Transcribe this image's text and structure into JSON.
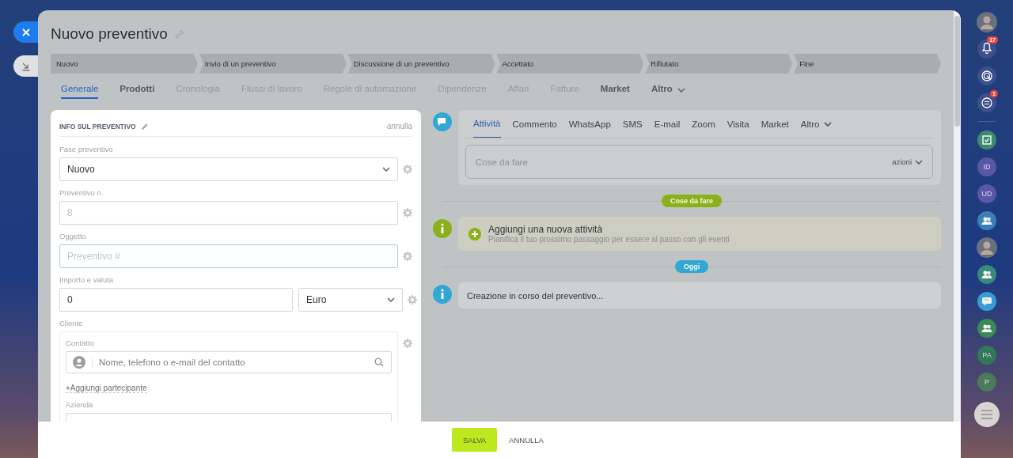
{
  "header": {
    "title": "Nuovo preventivo"
  },
  "stages": [
    {
      "label": "Nuovo"
    },
    {
      "label": "Invio di un preventivo"
    },
    {
      "label": "Discussione di un preventivo"
    },
    {
      "label": "Accettato"
    },
    {
      "label": "Rifiutato"
    },
    {
      "label": "Fine"
    }
  ],
  "tabs": [
    {
      "label": "Generale",
      "selected": true,
      "disabled": false,
      "dropdown": false
    },
    {
      "label": "Prodotti",
      "selected": false,
      "disabled": false,
      "dropdown": false
    },
    {
      "label": "Cronologia",
      "selected": false,
      "disabled": true,
      "dropdown": false
    },
    {
      "label": "Flussi di lavoro",
      "selected": false,
      "disabled": true,
      "dropdown": false
    },
    {
      "label": "Regole di automazione",
      "selected": false,
      "disabled": true,
      "dropdown": false
    },
    {
      "label": "Dipendenze",
      "selected": false,
      "disabled": true,
      "dropdown": false
    },
    {
      "label": "Affari",
      "selected": false,
      "disabled": true,
      "dropdown": false
    },
    {
      "label": "Fatture",
      "selected": false,
      "disabled": true,
      "dropdown": false
    },
    {
      "label": "Market",
      "selected": false,
      "disabled": false,
      "dropdown": false
    },
    {
      "label": "Altro",
      "selected": false,
      "disabled": false,
      "dropdown": true
    }
  ],
  "info_card": {
    "title": "INFO SUL PREVENTIVO",
    "cancel": "annulla",
    "fields": [
      {
        "kind": "select",
        "label": "Fase preventivo",
        "value": "Nuovo"
      },
      {
        "kind": "input",
        "label": "Preventivo n.",
        "placeholder": "8",
        "focused": false
      },
      {
        "kind": "input",
        "label": "Oggetto",
        "placeholder": "Preventivo #",
        "focused": true
      },
      {
        "kind": "money",
        "label": "Importo e valuta",
        "value": "0",
        "currency": "Euro"
      },
      {
        "kind": "client",
        "label": "Cliente",
        "contact_label": "Contatto",
        "contact_placeholder": "Nome, telefono o e-mail del contatto",
        "add_link": "+Aggiungi partecipante",
        "company_label": "Azienda"
      }
    ]
  },
  "timeline": {
    "tabs": [
      {
        "label": "Attività",
        "selected": true,
        "dropdown": false
      },
      {
        "label": "Commento",
        "selected": false,
        "dropdown": false
      },
      {
        "label": "WhatsApp",
        "selected": false,
        "dropdown": false
      },
      {
        "label": "SMS",
        "selected": false,
        "dropdown": false
      },
      {
        "label": "E-mail",
        "selected": false,
        "dropdown": false
      },
      {
        "label": "Zoom",
        "selected": false,
        "dropdown": false
      },
      {
        "label": "Visita",
        "selected": false,
        "dropdown": false
      },
      {
        "label": "Market",
        "selected": false,
        "dropdown": false
      },
      {
        "label": "Altro",
        "selected": false,
        "dropdown": true
      }
    ],
    "input_placeholder": "Cose da fare",
    "actions": "azioni",
    "sections": [
      {
        "kind": "divider",
        "label": "Cose da fare",
        "color": "#8cb01a"
      },
      {
        "kind": "add",
        "title": "Aggiungi una nuova attività",
        "subtitle": "Pianifica il tuo prossimo passaggio per essere al passo con gli eventi"
      },
      {
        "kind": "divider",
        "label": "Oggi",
        "color": "#32a7d6"
      },
      {
        "kind": "event",
        "text": "Creazione in corso del preventivo..."
      }
    ]
  },
  "footer": {
    "save": "SALVA",
    "cancel": "ANNULLA"
  },
  "sidebar": {
    "items": [
      {
        "kind": "avatar"
      },
      {
        "kind": "bell",
        "badge": "17"
      },
      {
        "kind": "spiral"
      },
      {
        "kind": "chat",
        "badge": "1"
      },
      {
        "kind": "divider"
      },
      {
        "kind": "task",
        "color": "#3d8a6e"
      },
      {
        "kind": "initials",
        "text": "ID",
        "color": "#5a57a8"
      },
      {
        "kind": "initials",
        "text": "UD",
        "color": "#5a57a8"
      },
      {
        "kind": "group",
        "color": "#3a7fb8"
      },
      {
        "kind": "avatar"
      },
      {
        "kind": "group",
        "color": "#3a8a7a"
      },
      {
        "kind": "chat-bubble",
        "color": "#3a9ad6"
      },
      {
        "kind": "group",
        "color": "#3a8a55"
      },
      {
        "kind": "initials",
        "text": "PA",
        "color": "#2f7a55"
      },
      {
        "kind": "initials",
        "text": "P",
        "color": "#4a7a5a"
      },
      {
        "kind": "menu"
      }
    ]
  }
}
